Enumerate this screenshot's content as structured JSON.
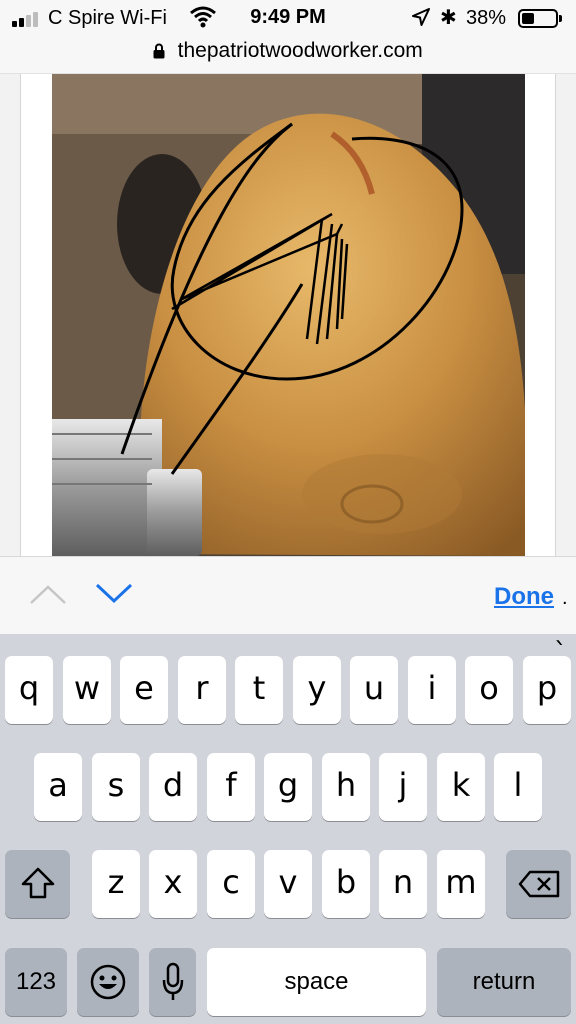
{
  "status_bar": {
    "carrier": "C Spire Wi-Fi",
    "time": "9:49 PM",
    "battery_percent": "38%",
    "battery_level": 0.38,
    "bluetooth_glyph": "✱",
    "icons": [
      "signal-icon",
      "wifi-icon",
      "location-arrow-icon",
      "bluetooth-icon",
      "battery-icon"
    ]
  },
  "url_bar": {
    "url": "thepatriotwoodworker.com",
    "icon": "lock-icon"
  },
  "content": {
    "image": "photo of wood bowl turning on lathe with hand-drawn circle annotation"
  },
  "find_toolbar": {
    "done_label": "Done",
    "trailing": ".",
    "icons": [
      "chevron-up-icon",
      "chevron-down-icon"
    ]
  },
  "keyboard": {
    "row1": [
      "q",
      "w",
      "e",
      "r",
      "t",
      "y",
      "u",
      "i",
      "o",
      "p"
    ],
    "row2": [
      "a",
      "s",
      "d",
      "f",
      "g",
      "h",
      "j",
      "k",
      "l"
    ],
    "row3": [
      "z",
      "x",
      "c",
      "v",
      "b",
      "n",
      "m"
    ],
    "accent_on_p": "`",
    "numbers_label": "123",
    "space_label": "space",
    "return_label": "return",
    "icons": [
      "shift-icon",
      "delete-icon",
      "emoji-icon",
      "microphone-icon"
    ]
  },
  "colors": {
    "accent": "#1a73e8",
    "keyboard_bg": "#d1d4da",
    "key_dark": "#acb3bd"
  }
}
